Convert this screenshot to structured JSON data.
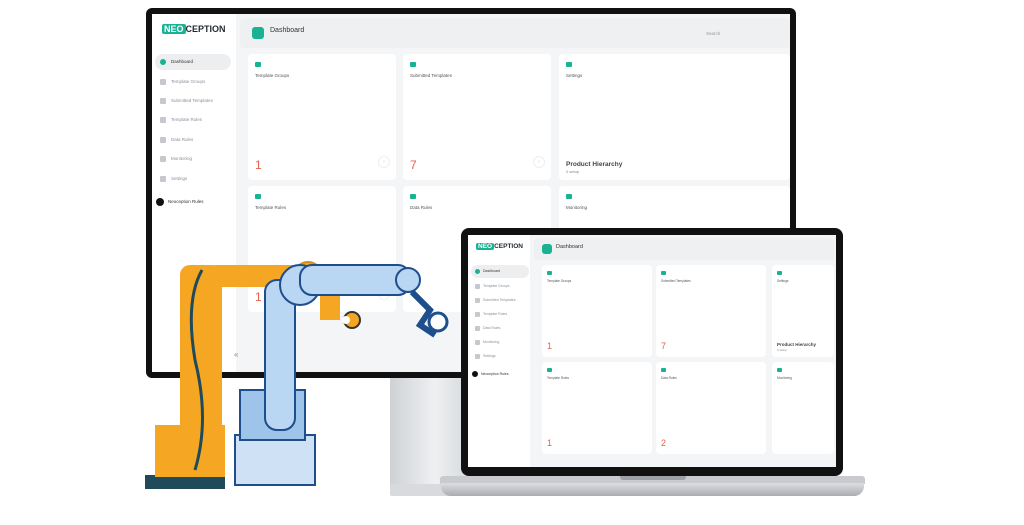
{
  "brand": {
    "neo": "NEO",
    "rest": "CEPTION"
  },
  "header": {
    "title": "Dashboard",
    "search_placeholder": "Search"
  },
  "sidebar": {
    "items": [
      {
        "label": "Dashboard",
        "icon": "dashboard-icon"
      },
      {
        "label": "Template Groups",
        "icon": "folder-icon"
      },
      {
        "label": "Submitted Templates",
        "icon": "document-icon"
      },
      {
        "label": "Template Rules",
        "icon": "rules-icon"
      },
      {
        "label": "Data Rules",
        "icon": "bulb-icon"
      },
      {
        "label": "Monitoring",
        "icon": "monitor-icon"
      },
      {
        "label": "Settings",
        "icon": "gear-icon"
      }
    ],
    "user": "Neoception Rules",
    "collapse": "«"
  },
  "cards": [
    {
      "title": "Template Groups",
      "count": "1"
    },
    {
      "title": "Submitted Templates",
      "count": "7"
    },
    {
      "title": "Settings",
      "subtitle": "Product Hierarchy",
      "note": "0 setup"
    },
    {
      "title": "Template Rules",
      "count": "1"
    },
    {
      "title": "Data Rules",
      "count": "2"
    },
    {
      "title": "Monitoring"
    }
  ],
  "colors": {
    "accent": "#19b394",
    "count": "#e2624f",
    "robot_orange": "#f5a623",
    "robot_blue": "#1f4e8c"
  }
}
